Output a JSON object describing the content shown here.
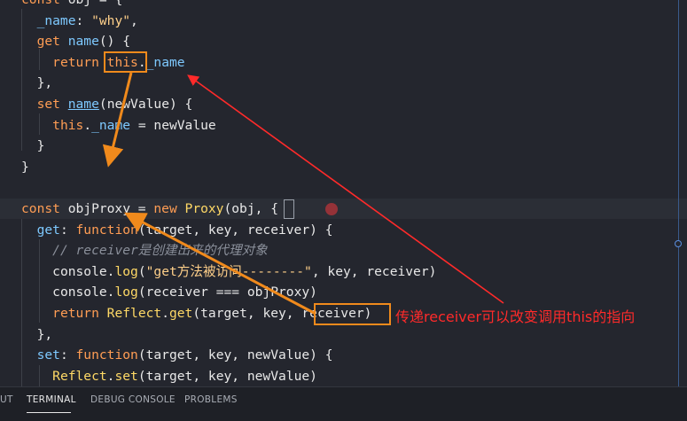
{
  "code_lines": [
    [
      [
        "t-kw",
        "const "
      ],
      [
        "t-plain",
        "obj "
      ],
      [
        "t-punc",
        "= {"
      ]
    ],
    [
      [
        "t-plain",
        "  "
      ],
      [
        "t-prop",
        "_name"
      ],
      [
        "t-punc",
        ": "
      ],
      [
        "t-str",
        "\"why\""
      ],
      [
        "t-punc",
        ","
      ]
    ],
    [
      [
        "t-plain",
        "  "
      ],
      [
        "t-kw",
        "get "
      ],
      [
        "t-prop",
        "name"
      ],
      [
        "t-punc",
        "() {"
      ]
    ],
    [
      [
        "t-plain",
        "    "
      ],
      [
        "t-kw",
        "return "
      ],
      [
        "t-kw",
        "this"
      ],
      [
        "t-punc",
        "."
      ],
      [
        "t-prop",
        "_name"
      ]
    ],
    [
      [
        "t-plain",
        "  "
      ],
      [
        "t-punc",
        "},"
      ]
    ],
    [
      [
        "t-plain",
        "  "
      ],
      [
        "t-kw",
        "set "
      ],
      [
        "t-prop t-ul",
        "name"
      ],
      [
        "t-punc",
        "("
      ],
      [
        "t-plain",
        "newValue"
      ],
      [
        "t-punc",
        ") {"
      ]
    ],
    [
      [
        "t-plain",
        "    "
      ],
      [
        "t-kw",
        "this"
      ],
      [
        "t-punc",
        "."
      ],
      [
        "t-prop",
        "_name "
      ],
      [
        "t-punc",
        "= "
      ],
      [
        "t-plain",
        "newValue"
      ]
    ],
    [
      [
        "t-plain",
        "  "
      ],
      [
        "t-punc",
        "}"
      ]
    ],
    [
      [
        "t-punc",
        "}"
      ]
    ],
    [
      [
        "t-plain",
        ""
      ]
    ],
    [
      [
        "t-kw",
        "const "
      ],
      [
        "t-plain",
        "objProxy "
      ],
      [
        "t-punc",
        "= "
      ],
      [
        "t-kw",
        "new "
      ],
      [
        "t-fn",
        "Proxy"
      ],
      [
        "t-punc",
        "("
      ],
      [
        "t-plain",
        "obj"
      ],
      [
        "t-punc",
        ", {"
      ]
    ],
    [
      [
        "t-plain",
        "  "
      ],
      [
        "t-prop",
        "get"
      ],
      [
        "t-punc",
        ": "
      ],
      [
        "t-kw",
        "function"
      ],
      [
        "t-punc",
        "("
      ],
      [
        "t-plain",
        "target"
      ],
      [
        "t-punc",
        ", "
      ],
      [
        "t-plain",
        "key"
      ],
      [
        "t-punc",
        ", "
      ],
      [
        "t-plain",
        "receiver"
      ],
      [
        "t-punc",
        ") {"
      ]
    ],
    [
      [
        "t-plain",
        "    "
      ],
      [
        "t-cm",
        "// receiver是创建出来的代理对象"
      ]
    ],
    [
      [
        "t-plain",
        "    "
      ],
      [
        "t-plain",
        "console"
      ],
      [
        "t-punc",
        "."
      ],
      [
        "t-fn",
        "log"
      ],
      [
        "t-punc",
        "("
      ],
      [
        "t-str",
        "\"get方法被访问--------\""
      ],
      [
        "t-punc",
        ", "
      ],
      [
        "t-plain",
        "key"
      ],
      [
        "t-punc",
        ", "
      ],
      [
        "t-plain",
        "receiver"
      ],
      [
        "t-punc",
        ")"
      ]
    ],
    [
      [
        "t-plain",
        "    "
      ],
      [
        "t-plain",
        "console"
      ],
      [
        "t-punc",
        "."
      ],
      [
        "t-fn",
        "log"
      ],
      [
        "t-punc",
        "("
      ],
      [
        "t-plain",
        "receiver "
      ],
      [
        "t-punc",
        "=== "
      ],
      [
        "t-plain",
        "objProxy"
      ],
      [
        "t-punc",
        ")"
      ]
    ],
    [
      [
        "t-plain",
        "    "
      ],
      [
        "t-kw",
        "return "
      ],
      [
        "t-fn",
        "Reflect"
      ],
      [
        "t-punc",
        "."
      ],
      [
        "t-fn",
        "get"
      ],
      [
        "t-punc",
        "("
      ],
      [
        "t-plain",
        "target"
      ],
      [
        "t-punc",
        ", "
      ],
      [
        "t-plain",
        "key"
      ],
      [
        "t-punc",
        ", "
      ],
      [
        "t-plain",
        "receiver"
      ],
      [
        "t-punc",
        ")"
      ]
    ],
    [
      [
        "t-plain",
        "  "
      ],
      [
        "t-punc",
        "},"
      ]
    ],
    [
      [
        "t-plain",
        "  "
      ],
      [
        "t-prop",
        "set"
      ],
      [
        "t-punc",
        ": "
      ],
      [
        "t-kw",
        "function"
      ],
      [
        "t-punc",
        "("
      ],
      [
        "t-plain",
        "target"
      ],
      [
        "t-punc",
        ", "
      ],
      [
        "t-plain",
        "key"
      ],
      [
        "t-punc",
        ", "
      ],
      [
        "t-plain",
        "newValue"
      ],
      [
        "t-punc",
        ") {"
      ]
    ],
    [
      [
        "t-plain",
        "    "
      ],
      [
        "t-fn",
        "Reflect"
      ],
      [
        "t-punc",
        "."
      ],
      [
        "t-fn",
        "set"
      ],
      [
        "t-punc",
        "("
      ],
      [
        "t-plain",
        "target"
      ],
      [
        "t-punc",
        ", "
      ],
      [
        "t-plain",
        "key"
      ],
      [
        "t-punc",
        ", "
      ],
      [
        "t-plain",
        "newValue"
      ],
      [
        "t-punc",
        ")"
      ]
    ]
  ],
  "annotation": "传递receiver可以改变调用this的指向",
  "panel_tabs": [
    "UT",
    "TERMINAL",
    "DEBUG CONSOLE",
    "PROBLEMS"
  ],
  "active_tab": "TERMINAL",
  "colors": {
    "background": "#24262e",
    "highlight_box": "#f08a1c",
    "annotation": "#ff2a2a",
    "keyword": "#ff9d54",
    "property": "#7ec9ff"
  }
}
